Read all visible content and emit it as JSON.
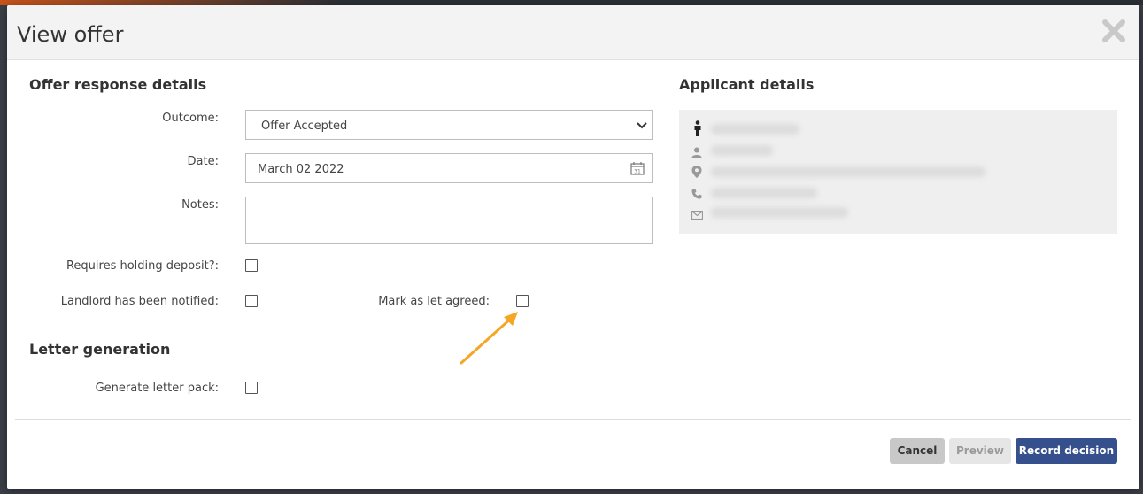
{
  "modal": {
    "title": "View offer"
  },
  "offer_response": {
    "section_title": "Offer response details",
    "outcome_label": "Outcome:",
    "outcome_value": "Offer Accepted",
    "date_label": "Date:",
    "date_value": "March 02 2022",
    "notes_label": "Notes:",
    "notes_value": "",
    "holding_deposit_label": "Requires holding deposit?:",
    "holding_deposit_checked": false,
    "landlord_notified_label": "Landlord has been notified:",
    "landlord_notified_checked": false,
    "let_agreed_label": "Mark as let agreed:",
    "let_agreed_checked": false
  },
  "letter_generation": {
    "section_title": "Letter generation",
    "letter_pack_label": "Generate letter pack:",
    "letter_pack_checked": false
  },
  "applicant": {
    "section_title": "Applicant details",
    "icons": [
      "person-icon",
      "user-icon",
      "location-pin-icon",
      "phone-icon",
      "envelope-icon"
    ]
  },
  "footer": {
    "cancel_label": "Cancel",
    "preview_label": "Preview",
    "record_label": "Record decision"
  },
  "colors": {
    "primary": "#36508e",
    "annotation_arrow": "#f5a623"
  }
}
